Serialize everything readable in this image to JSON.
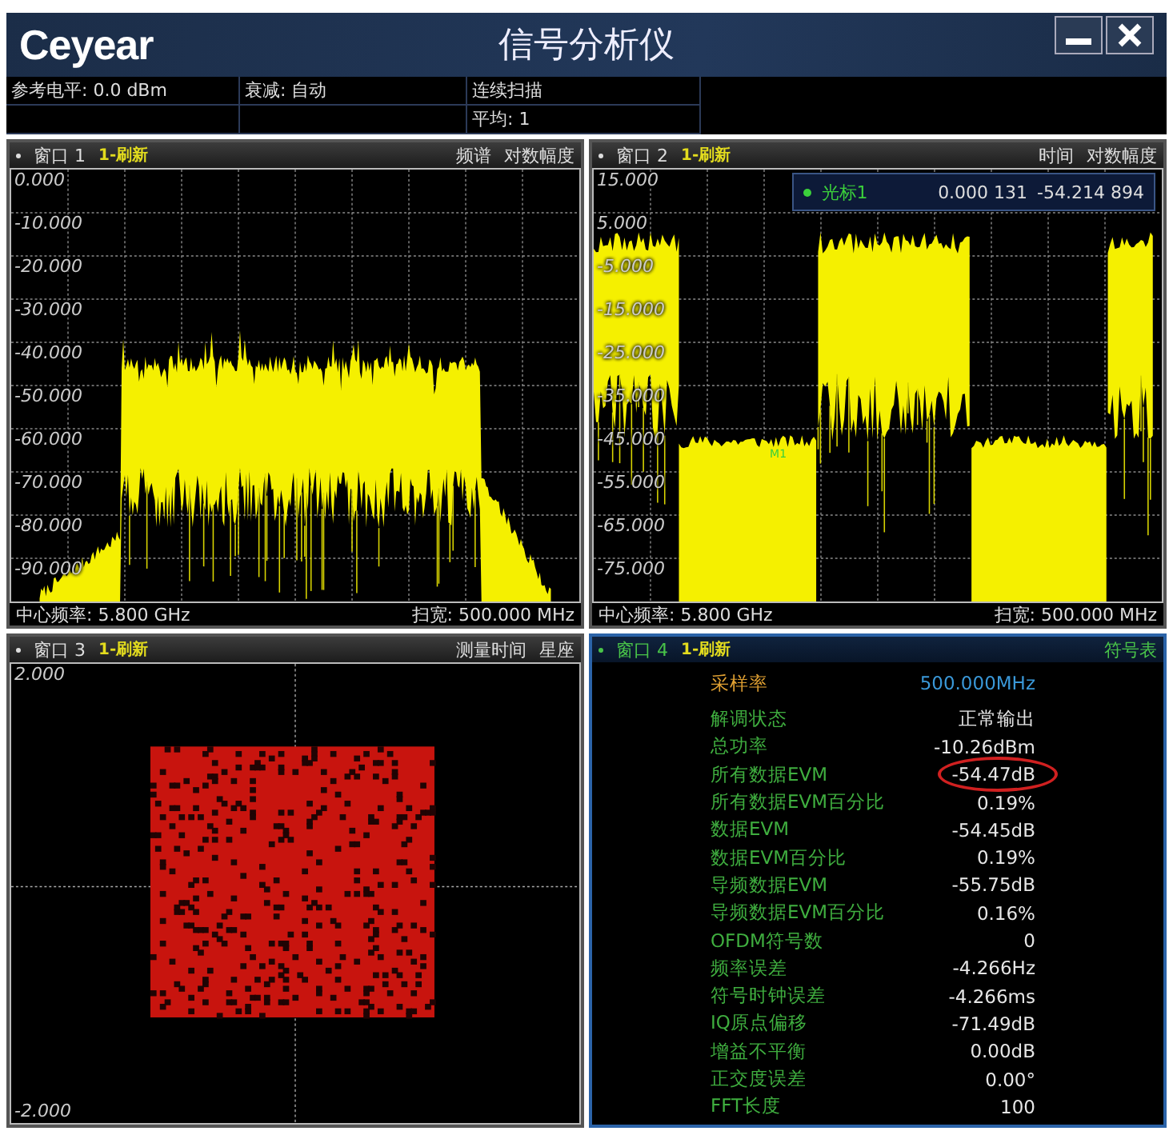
{
  "title_bar": {
    "logo": "Ceyear",
    "title": "信号分析仪"
  },
  "info_bar": {
    "column_1": [
      "参考电平: 0.0 dBm"
    ],
    "column_2": [
      "衰减: 自动"
    ],
    "column_3": [
      "连续扫描",
      "平均: 1"
    ]
  },
  "windows": [
    {
      "kind": "spectrum",
      "title": "窗口 1",
      "status": "1-刷新",
      "labels": [
        "频谱",
        "对数幅度"
      ],
      "active": false,
      "y_labels": [
        "0.000",
        "-10.000",
        "-20.000",
        "-30.000",
        "-40.000",
        "-50.000",
        "-60.000",
        "-70.000",
        "-80.000",
        "-90.000"
      ],
      "footer": {
        "left": "中心频率: 5.800 GHz",
        "right": "扫宽: 500.000 MHz"
      }
    },
    {
      "kind": "time",
      "title": "窗口 2",
      "status": "1-刷新",
      "labels": [
        "时间",
        "对数幅度"
      ],
      "active": false,
      "y_labels": [
        "15.000",
        "5.000",
        "-5.000",
        "-15.000",
        "-25.000",
        "-35.000",
        "-45.000",
        "-55.000",
        "-65.000",
        "-75.000"
      ],
      "marker": {
        "label": "光标1",
        "x_value": "0.000 131",
        "y_value": "-54.214 894",
        "trace_label": "M1"
      },
      "footer": {
        "left": "中心频率: 5.800 GHz",
        "right": "扫宽: 500.000 MHz"
      }
    },
    {
      "kind": "constellation",
      "title": "窗口 3",
      "status": "1-刷新",
      "labels": [
        "测量时间",
        "星座"
      ],
      "active": false,
      "y_labels": [
        "2.000",
        "-2.000"
      ]
    },
    {
      "kind": "table",
      "title": "窗口 4",
      "status": "1-刷新",
      "labels": [
        "符号表"
      ],
      "active": true,
      "rows": [
        {
          "kind": "header",
          "label": "采样率",
          "value": "500.000MHz",
          "highlighted": false
        },
        {
          "kind": "row",
          "label": "解调状态",
          "value": "正常输出",
          "highlighted": false
        },
        {
          "kind": "row",
          "label": "总功率",
          "value": "-10.26dBm",
          "highlighted": false
        },
        {
          "kind": "row",
          "label": "所有数据EVM",
          "value": "-54.47dB",
          "highlighted": true
        },
        {
          "kind": "row",
          "label": "所有数据EVM百分比",
          "value": "0.19%",
          "highlighted": false
        },
        {
          "kind": "row",
          "label": "数据EVM",
          "value": "-54.45dB",
          "highlighted": false
        },
        {
          "kind": "row",
          "label": "数据EVM百分比",
          "value": "0.19%",
          "highlighted": false
        },
        {
          "kind": "row",
          "label": "导频数据EVM",
          "value": "-55.75dB",
          "highlighted": false
        },
        {
          "kind": "row",
          "label": "导频数据EVM百分比",
          "value": "0.16%",
          "highlighted": false
        },
        {
          "kind": "row",
          "label": "OFDM符号数",
          "value": "0",
          "highlighted": false
        },
        {
          "kind": "row",
          "label": "频率误差",
          "value": "-4.266Hz",
          "highlighted": false
        },
        {
          "kind": "row",
          "label": "符号时钟误差",
          "value": "-4.266ms",
          "highlighted": false
        },
        {
          "kind": "row",
          "label": "IQ原点偏移",
          "value": "-71.49dB",
          "highlighted": false
        },
        {
          "kind": "row",
          "label": "增益不平衡",
          "value": "0.00dB",
          "highlighted": false
        },
        {
          "kind": "row",
          "label": "正交度误差",
          "value": "0.00°",
          "highlighted": false
        },
        {
          "kind": "row",
          "label": "FFT长度",
          "value": "100",
          "highlighted": false
        }
      ]
    }
  ]
}
